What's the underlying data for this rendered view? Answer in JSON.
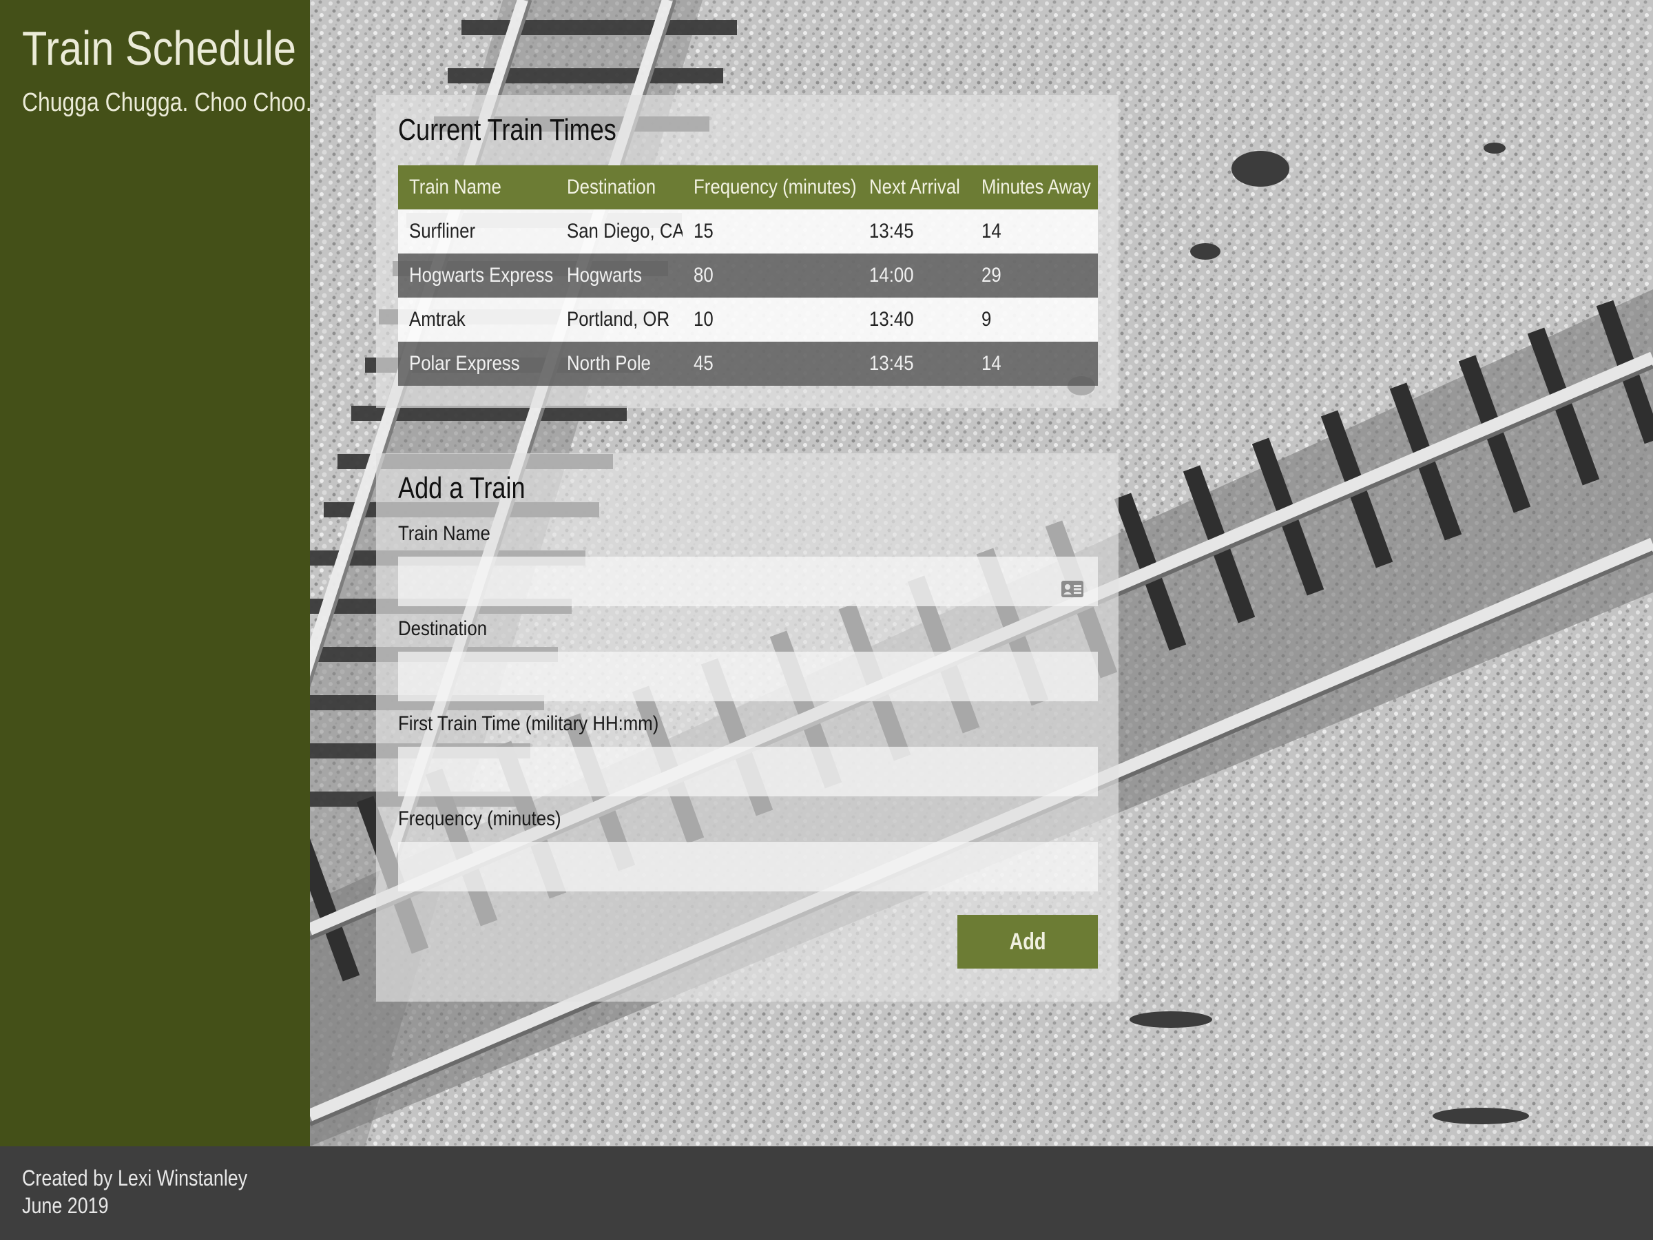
{
  "sidebar": {
    "title": "Train Schedule",
    "tagline": "Chugga Chugga. Choo Choo."
  },
  "schedule": {
    "heading": "Current Train Times",
    "columns": [
      "Train Name",
      "Destination",
      "Frequency (minutes)",
      "Next Arrival",
      "Minutes Away"
    ],
    "rows": [
      [
        "Surfliner",
        "San Diego, CA",
        "15",
        "13:45",
        "14"
      ],
      [
        "Hogwarts Express",
        "Hogwarts",
        "80",
        "14:00",
        "29"
      ],
      [
        "Amtrak",
        "Portland, OR",
        "10",
        "13:40",
        "9"
      ],
      [
        "Polar Express",
        "North Pole",
        "45",
        "13:45",
        "14"
      ]
    ]
  },
  "form": {
    "heading": "Add a Train",
    "fields": [
      {
        "label": "Train Name",
        "value": ""
      },
      {
        "label": "Destination",
        "value": ""
      },
      {
        "label": "First Train Time (military HH:mm)",
        "value": ""
      },
      {
        "label": "Frequency (minutes)",
        "value": ""
      }
    ],
    "submit_label": "Add",
    "autofill_icon": "contact-card-icon"
  },
  "footer": {
    "credit": "Created by Lexi Winstanley",
    "date": "June 2019"
  },
  "colors": {
    "sidebar": "#445018",
    "accent": "#6c7c34",
    "footer": "#3e3e3e"
  }
}
